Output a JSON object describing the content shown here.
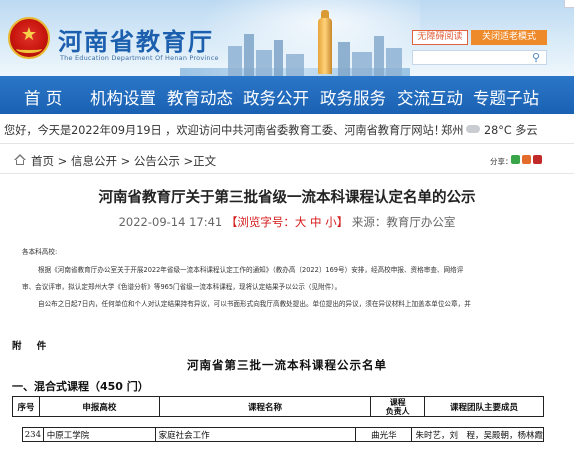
{
  "header": {
    "site_title": "河南省教育厅",
    "site_subtitle": "The Education Department Of Henan Province",
    "accessible_btn": "无障碍阅读",
    "elder_btn": "关闭适老模式",
    "search_placeholder": ""
  },
  "nav": {
    "items": [
      "首 页",
      "机构设置",
      "教育动态",
      "政务公开",
      "政务服务",
      "交流互动",
      "专题子站"
    ]
  },
  "welcome": {
    "text": "您好，今天是2022年09月19日 ，欢迎访问中共河南省委教育工委、河南省教育厅网站！",
    "city": "郑州",
    "weather": "28°C 多云"
  },
  "breadcrumb": {
    "text": "首页 > 信息公开 > 公告公示 >正文",
    "share_label": "分享："
  },
  "article": {
    "title": "河南省教育厅关于第三批省级一流本科课程认定名单的公示",
    "date": "2022-09-14 17:41",
    "browse_text": "【浏览字号：大 中 小】",
    "source": "来源：教育厅办公室",
    "para_salutation": "各本科高校:",
    "para1_line1": "根据《河南省教育厅办公室关于开展2022年省级一流本科课程认定工作的通知》（教办高〔2022〕169号）安排，经高校申报、资格审查、网络评",
    "para1_line2": "审、会议评审，拟认定郑州大学《色谱分析》等965门省级一流本科课程，现将认定结果予以公示（见附件）。",
    "para2_line1": "自公布之日起7日内，任何单位和个人对认定结果持有异议，可以书面形式向我厅高教处提出。单位提出的异议，须在异议材料上加盖本单位公章，并"
  },
  "attachment": {
    "label": "附 件",
    "title": "河南省第三批一流本科课程公示名单",
    "section": "一、混合式课程（450 门）",
    "headers": [
      "序号",
      "申报高校",
      "课程名称",
      "课程\n负责人",
      "课程团队主要成员"
    ],
    "rows": [
      [
        "234",
        "中原工学院",
        "家庭社会工作",
        "曲光华",
        "朱时艺，刘　程，吴殿朝，杨林霞"
      ]
    ]
  }
}
